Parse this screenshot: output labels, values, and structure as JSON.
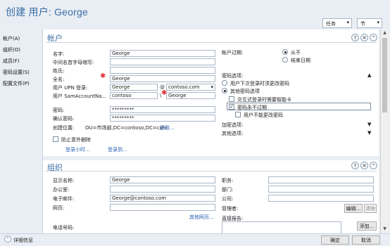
{
  "header": {
    "title": "创建 用户: George",
    "tasks_label": "任务",
    "sections_label": "节"
  },
  "nav": {
    "items": [
      "帐户(A)",
      "组织(O)",
      "成员(F)",
      "密码设置(S)",
      "配置文件(P)"
    ]
  },
  "account": {
    "heading": "帐户",
    "labels": {
      "first_name": "名字:",
      "middle_initials": "中间名首字母缩写:",
      "last_name": "姓氏:",
      "full_name": "全名:",
      "upn": "用户 UPN 登录:",
      "sam": "用户 SamAccountNa...",
      "password": "密码:",
      "confirm_password": "确认密码:",
      "create_in": "创建位置:"
    },
    "values": {
      "first_name": "George",
      "middle_initials": "",
      "last_name": "",
      "full_name": "George",
      "upn_user": "George",
      "upn_at": "@",
      "upn_domain": "contoso.com",
      "sam_domain": "contoso",
      "sam_sep": "\\",
      "sam_user": "George",
      "password": "*********",
      "confirm_password": "*********",
      "ou_path": "OU=市场部,DC=contoso,DC=com",
      "change_link": "更改..."
    },
    "protect_label": "防止意外删除",
    "logon_hours_link": "登录小时...",
    "logon_to_link": "登录到...",
    "expiry": {
      "label": "帐户过期:",
      "never": "从不",
      "end_of": "结束日期"
    },
    "password_options": {
      "label": "密码选项:",
      "must_change": "用户下次登录时须更改密码",
      "other": "其他密码选项",
      "smartcard": "交互式登录时需要智能卡",
      "never_expires": "密码永不过期",
      "cannot_change": "用户不能更改密码"
    },
    "encryption_label": "加密选项:",
    "other_options_label": "其他选项:"
  },
  "org": {
    "heading": "组织",
    "labels": {
      "display_name": "显示名称:",
      "office": "办公室:",
      "email": "电子邮件:",
      "web_page": "网页:",
      "phone": "电话号码:",
      "job_title": "职务:",
      "department": "部门:",
      "company": "公司:",
      "manager": "管理者:",
      "direct_reports": "直接报告:"
    },
    "values": {
      "display_name": "George",
      "office": "",
      "email": "George@contoso.com",
      "web_page": ""
    },
    "more_web_link": "其他网页...",
    "edit_btn": "编辑...",
    "clear_btn": "清除",
    "add_btn": "添加..."
  },
  "footer": {
    "details": "详细信息",
    "ok": "确定",
    "cancel": "取消"
  }
}
